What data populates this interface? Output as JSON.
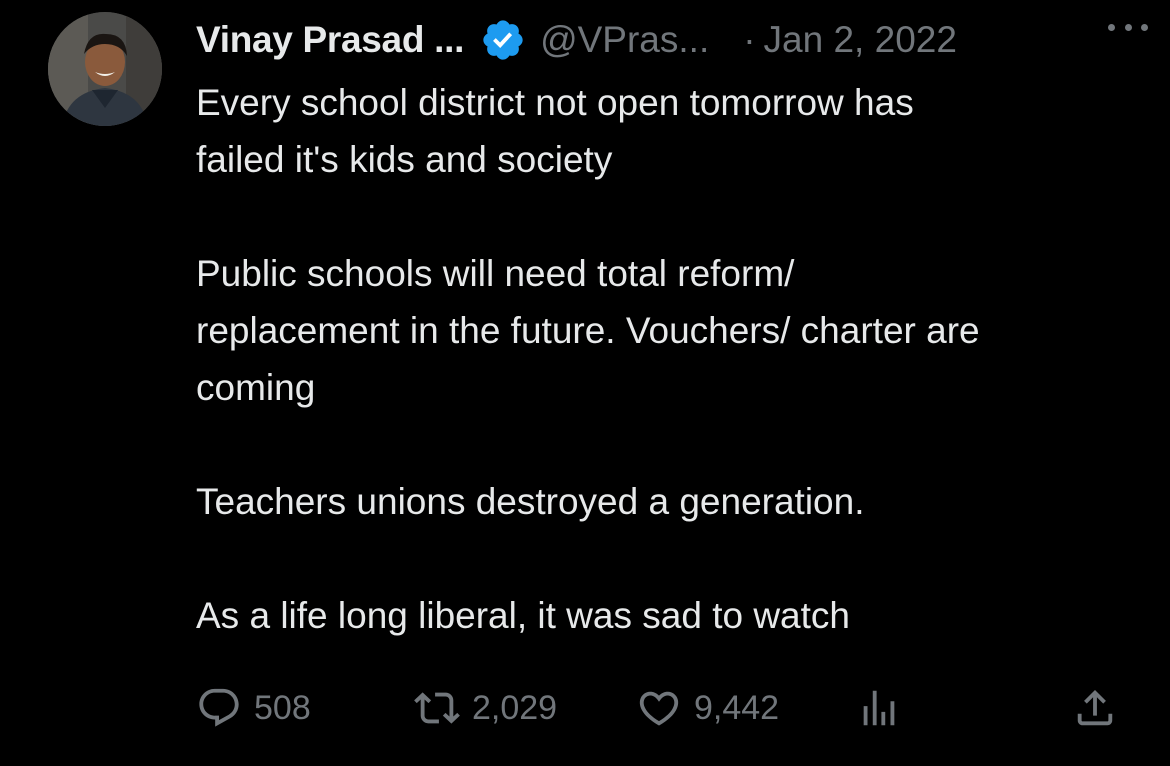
{
  "tweet": {
    "author": {
      "name": "Vinay Prasad ...",
      "handle": "@VPras...",
      "verified": true,
      "verified_color": "#1d9bf0"
    },
    "separator": "·",
    "date": "Jan 2, 2022",
    "more_icon": "more-horizontal-icon",
    "paragraphs": [
      "Every school district not open tomorrow has\nfailed it's kids and society",
      "Public schools will need total reform/\nreplacement in the future. Vouchers/ charter are\ncoming",
      "Teachers unions destroyed a generation.",
      "As a life long liberal, it was sad to watch"
    ],
    "actions": {
      "reply": {
        "icon": "reply-icon",
        "count": "508"
      },
      "retweet": {
        "icon": "retweet-icon",
        "count": "2,029"
      },
      "like": {
        "icon": "heart-icon",
        "count": "9,442"
      },
      "views": {
        "icon": "views-icon"
      },
      "share": {
        "icon": "share-icon"
      }
    }
  },
  "colors": {
    "background": "#000000",
    "text": "#e7e9ea",
    "secondary": "#71767b",
    "accent": "#1d9bf0"
  }
}
